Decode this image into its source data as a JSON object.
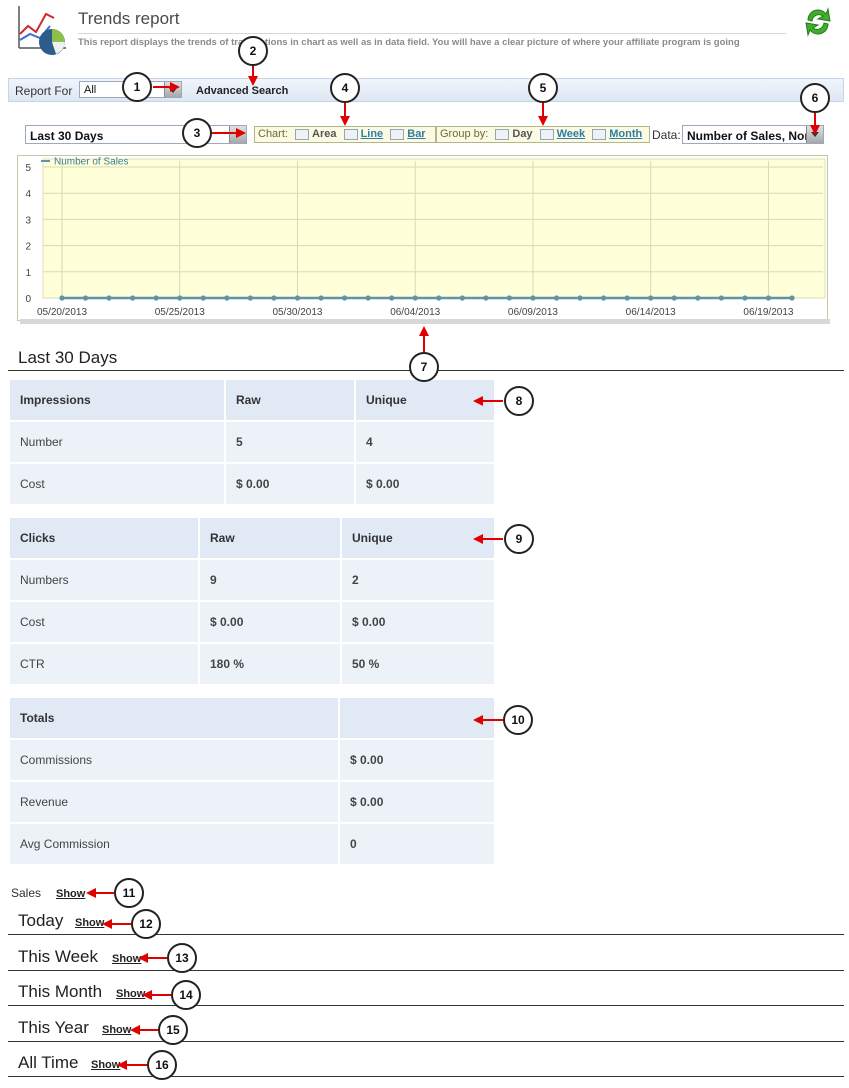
{
  "header": {
    "title": "Trends report",
    "description": "This report displays the trends of transactions in chart as well as in data field. You will have a clear picture of where your affiliate program is going"
  },
  "filter": {
    "report_for_label": "Report For",
    "report_for_value": "All",
    "advanced_search": "Advanced Search"
  },
  "controls": {
    "period": "Last 30 Days",
    "chart_label": "Chart:",
    "chart_types": [
      "Area",
      "Line",
      "Bar"
    ],
    "chart_type_selected": "Area",
    "group_by_label": "Group by:",
    "group_by": [
      "Day",
      "Week",
      "Month"
    ],
    "group_by_selected": "Day",
    "data_label": "Data:",
    "data_value": "Number of Sales, Non"
  },
  "chart_data": {
    "type": "line",
    "title": "",
    "legend": "top-left",
    "series": [
      {
        "name": "Number of Sales",
        "values": [
          0,
          0,
          0,
          0,
          0,
          0,
          0,
          0,
          0,
          0,
          0,
          0,
          0,
          0,
          0,
          0,
          0,
          0,
          0,
          0,
          0,
          0,
          0,
          0,
          0,
          0,
          0,
          0,
          0,
          0,
          0,
          0
        ]
      }
    ],
    "ylim": [
      0,
      5
    ],
    "yticks": [
      "0",
      "1",
      "2",
      "3",
      "4",
      "5"
    ],
    "xticks": [
      "05/20/2013",
      "05/25/2013",
      "05/30/2013",
      "06/04/2013",
      "06/09/2013",
      "06/14/2013",
      "06/19/2013"
    ],
    "grid": true,
    "colors": {
      "line": "#5f93a6",
      "bg": "#ffffd9",
      "grid": "#dadab0"
    }
  },
  "period_heading": "Last 30 Days",
  "impressions": {
    "headers": [
      "Impressions",
      "Raw",
      "Unique"
    ],
    "rows": [
      [
        "Number",
        "5",
        "4"
      ],
      [
        "Cost",
        "$ 0.00",
        "$ 0.00"
      ]
    ]
  },
  "clicks": {
    "headers": [
      "Clicks",
      "Raw",
      "Unique"
    ],
    "rows": [
      [
        "Numbers",
        "9",
        "2"
      ],
      [
        "Cost",
        "$ 0.00",
        "$ 0.00"
      ],
      [
        "CTR",
        "180 %",
        "50 %"
      ]
    ]
  },
  "totals": {
    "headers": [
      "Totals",
      ""
    ],
    "rows": [
      [
        "Commissions",
        "$ 0.00"
      ],
      [
        "Revenue",
        "$ 0.00"
      ],
      [
        "Avg Commission",
        "0"
      ]
    ]
  },
  "sales": {
    "label": "Sales",
    "show": "Show"
  },
  "sections": [
    {
      "title": "Today",
      "show": "Show"
    },
    {
      "title": "This Week",
      "show": "Show"
    },
    {
      "title": "This Month",
      "show": "Show"
    },
    {
      "title": "This Year",
      "show": "Show"
    },
    {
      "title": "All Time",
      "show": "Show"
    }
  ],
  "callouts": [
    "1",
    "2",
    "3",
    "4",
    "5",
    "6",
    "7",
    "8",
    "9",
    "10",
    "11",
    "12",
    "13",
    "14",
    "15",
    "16"
  ]
}
